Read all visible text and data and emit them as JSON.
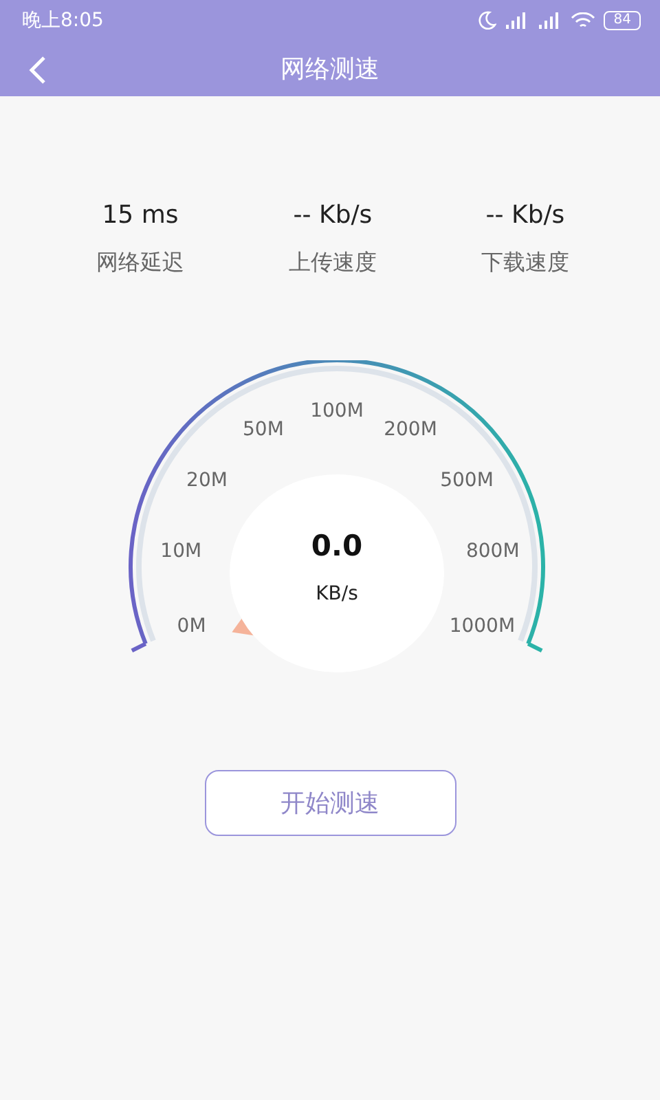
{
  "status_bar": {
    "time": "晚上8:05",
    "battery": "84"
  },
  "header": {
    "title": "网络测速"
  },
  "stats": [
    {
      "value": "15 ms",
      "label": "网络延迟"
    },
    {
      "value": "-- Kb/s",
      "label": "上传速度"
    },
    {
      "value": "-- Kb/s",
      "label": "下载速度"
    }
  ],
  "gauge": {
    "reading": "0.0",
    "unit": "KB/s",
    "scale": [
      "100M",
      "50M",
      "200M",
      "20M",
      "500M",
      "10M",
      "800M",
      "0M",
      "1000M"
    ]
  },
  "start_button": "开始测速"
}
